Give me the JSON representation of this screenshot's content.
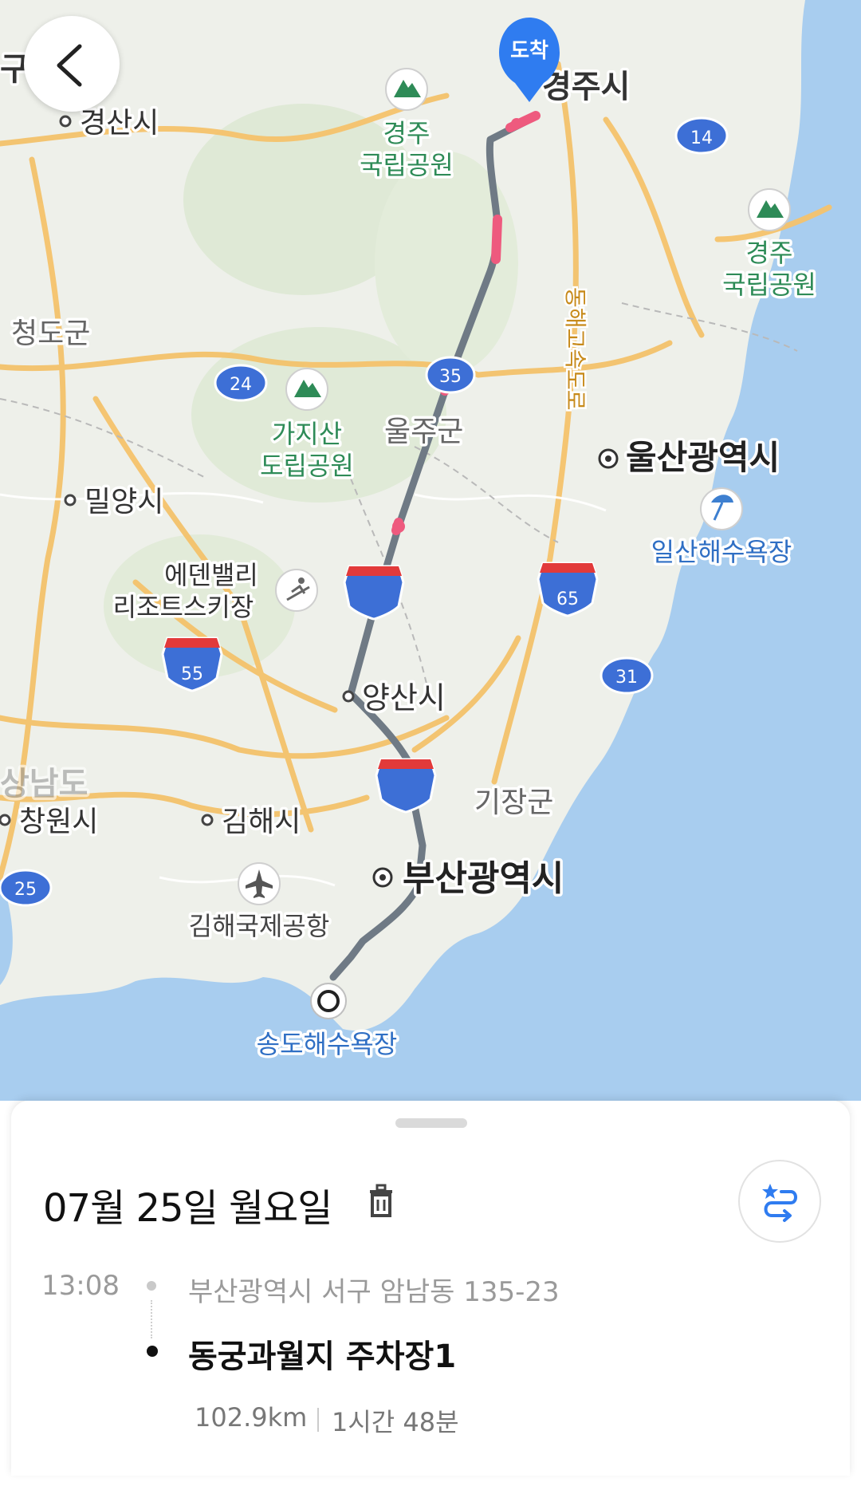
{
  "map": {
    "arrival_marker": "도착",
    "places": {
      "daegu": "구광역시",
      "gyeongsan": "경산시",
      "gyeongju_park_1": [
        "경주",
        "국립공원"
      ],
      "gyeongju_city": "경주시",
      "gyeongju_park_2": [
        "경주",
        "국립공원"
      ],
      "cheongdo": "청도군",
      "gajisan": [
        "가지산",
        "도립공원"
      ],
      "ulju": "울주군",
      "ulsan": "울산광역시",
      "ilsan_beach": "일산해수욕장",
      "miryang": "밀양시",
      "eden_valley": [
        "에덴밸리",
        "리조트스키장"
      ],
      "yangsan": "양산시",
      "gijang": "기장군",
      "changwon": "창원시",
      "gimhae": "김해시",
      "busan": "부산광역시",
      "gimhae_airport": "김해국제공항",
      "songdo_beach": "송도해수욕장",
      "gyeongnam_partial": "상남도",
      "donghae_expressway": "동해고속도로"
    },
    "road_shields": {
      "r14": "14",
      "r24": "24",
      "r35": "35",
      "r65": "65",
      "r31": "31",
      "r55": "55",
      "r25": "25"
    }
  },
  "trip": {
    "date": "07월 25일 월요일",
    "departure_time": "13:08",
    "origin": "부산광역시 서구 암남동 135-23",
    "destination": "동궁과월지 주차장1",
    "distance": "102.9km",
    "duration": "1시간 48분"
  },
  "colors": {
    "water": "#a8cdef",
    "land": "#eef0ea",
    "road_major": "#f4c26b",
    "route": "#6f7a85",
    "congestion": "#ee5a7e",
    "pin": "#2f7cf0",
    "park_green": "#2e8b57",
    "shield_blue": "#3d6fd6",
    "shield_red": "#e23a3a"
  },
  "icons": [
    "back-arrow-icon",
    "trash-icon",
    "swap-route-icon",
    "mountain-icon",
    "ski-icon",
    "airplane-icon",
    "beach-icon",
    "pin-icon"
  ]
}
